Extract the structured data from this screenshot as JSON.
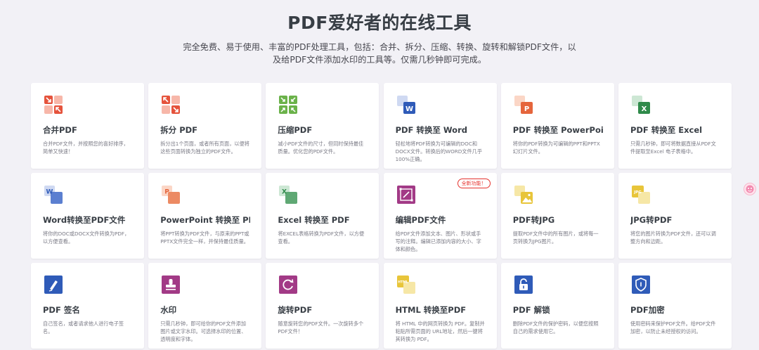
{
  "header": {
    "title": "PDF爱好者的在线工具",
    "subtitle": "完全免费、易于使用、丰富的PDF处理工具，包括：合并、拆分、压缩、转换、旋转和解锁PDF文件，以及给PDF文件添加水印的工具等。仅需几秒钟即可完成。"
  },
  "tools": [
    {
      "name": "合并PDF",
      "desc": "合并PDF文件，并按照您的喜好排序，简单又快速！",
      "icon": "merge-icon",
      "color": "#e5533c"
    },
    {
      "name": "拆分 PDF",
      "desc": "拆分出1个页面，或者所有页面，以便将这些页面转换为独立的PDF文件。",
      "icon": "split-icon",
      "color": "#e5533c"
    },
    {
      "name": "压缩PDF",
      "desc": "减小PDF文件的尺寸，但同时保持最佳质量。优化您的PDF文件。",
      "icon": "compress-icon",
      "color": "#6bb24a"
    },
    {
      "name": "PDF 转换至 Word",
      "desc": "轻松地将PDF转换为可编辑的DOC和DOCX文件。转换后的WORD文件几乎100%正确。",
      "icon": "pdf-to-word-icon",
      "color": "#2f5bb8"
    },
    {
      "name": "PDF 转换至 PowerPoint",
      "desc": "将你的PDF转换为可编辑的PPT和PPTX幻灯片文件。",
      "icon": "pdf-to-powerpoint-icon",
      "color": "#e5653c"
    },
    {
      "name": "PDF 转换至 Excel",
      "desc": "只需几秒钟，即可将数据直接从PDF文件提取至Excel 电子表格中。",
      "icon": "pdf-to-excel-icon",
      "color": "#2f8a4a"
    },
    {
      "name": "Word转换至PDF文件",
      "desc": "将你的DOC或DOCX文件转换为PDF，以方便查看。",
      "icon": "word-to-pdf-icon",
      "color": "#2f5bb8"
    },
    {
      "name": "PowerPoint 转换至 PDF",
      "desc": "将PPT转换为PDF文件，与原来的PPT或PPTX文件完全一样，并保持最佳质量。",
      "icon": "powerpoint-to-pdf-icon",
      "color": "#e5653c"
    },
    {
      "name": "Excel 转换至 PDF",
      "desc": "将EXCEL表格转换为PDF文件，以方便查看。",
      "icon": "excel-to-pdf-icon",
      "color": "#2f8a4a"
    },
    {
      "name": "编辑PDF文件",
      "desc": "给PDF文件添加文本、图片、形状或手写的注释。编辑已添加内容的大小、字体和颜色。",
      "icon": "edit-pdf-icon",
      "color": "#a23a86",
      "badge": "全新功能！"
    },
    {
      "name": "PDF转JPG",
      "desc": "提取PDF文件中的所有图片，或将每一页转换为JPG图片。",
      "icon": "pdf-to-jpg-icon",
      "color": "#e8c53a"
    },
    {
      "name": "JPG转PDF",
      "desc": "将您的图片转换为PDF文件，还可以调整方向和边距。",
      "icon": "jpg-to-pdf-icon",
      "color": "#e8c53a"
    },
    {
      "name": "PDF 签名",
      "desc": "自己签名，或者请求他人进行电子签名。",
      "icon": "sign-pdf-icon",
      "color": "#2f5bb8"
    },
    {
      "name": "水印",
      "desc": "只需几秒钟，即可给你的PDF文件添加图片或文字水印。可选择水印的位置、透明度和字体。",
      "icon": "watermark-icon",
      "color": "#a23a86"
    },
    {
      "name": "旋转PDF",
      "desc": "随意旋转您的PDF文件。一次旋转多个PDF文件！",
      "icon": "rotate-pdf-icon",
      "color": "#a23a86"
    },
    {
      "name": "HTML 转换至PDF",
      "desc": "将 HTML 中的网页转换为 PDF。复制并粘贴所需页面的 URL地址，然后一键将其转换为 PDF。",
      "icon": "html-to-pdf-icon",
      "color": "#e8c53a"
    },
    {
      "name": "PDF 解锁",
      "desc": "删除PDF文件的保护密码，以便您按照自己的需求使用它。",
      "icon": "unlock-pdf-icon",
      "color": "#2f5bb8"
    },
    {
      "name": "PDF加密",
      "desc": "使用密码来保护PDF文件。给PDF文件加密，以防止未经授权的访问。",
      "icon": "protect-pdf-icon",
      "color": "#2f5bb8"
    }
  ],
  "icon_labels": {
    "word": "W",
    "powerpoint": "P",
    "excel": "X",
    "jpg": "JPG",
    "html": "HTML"
  }
}
